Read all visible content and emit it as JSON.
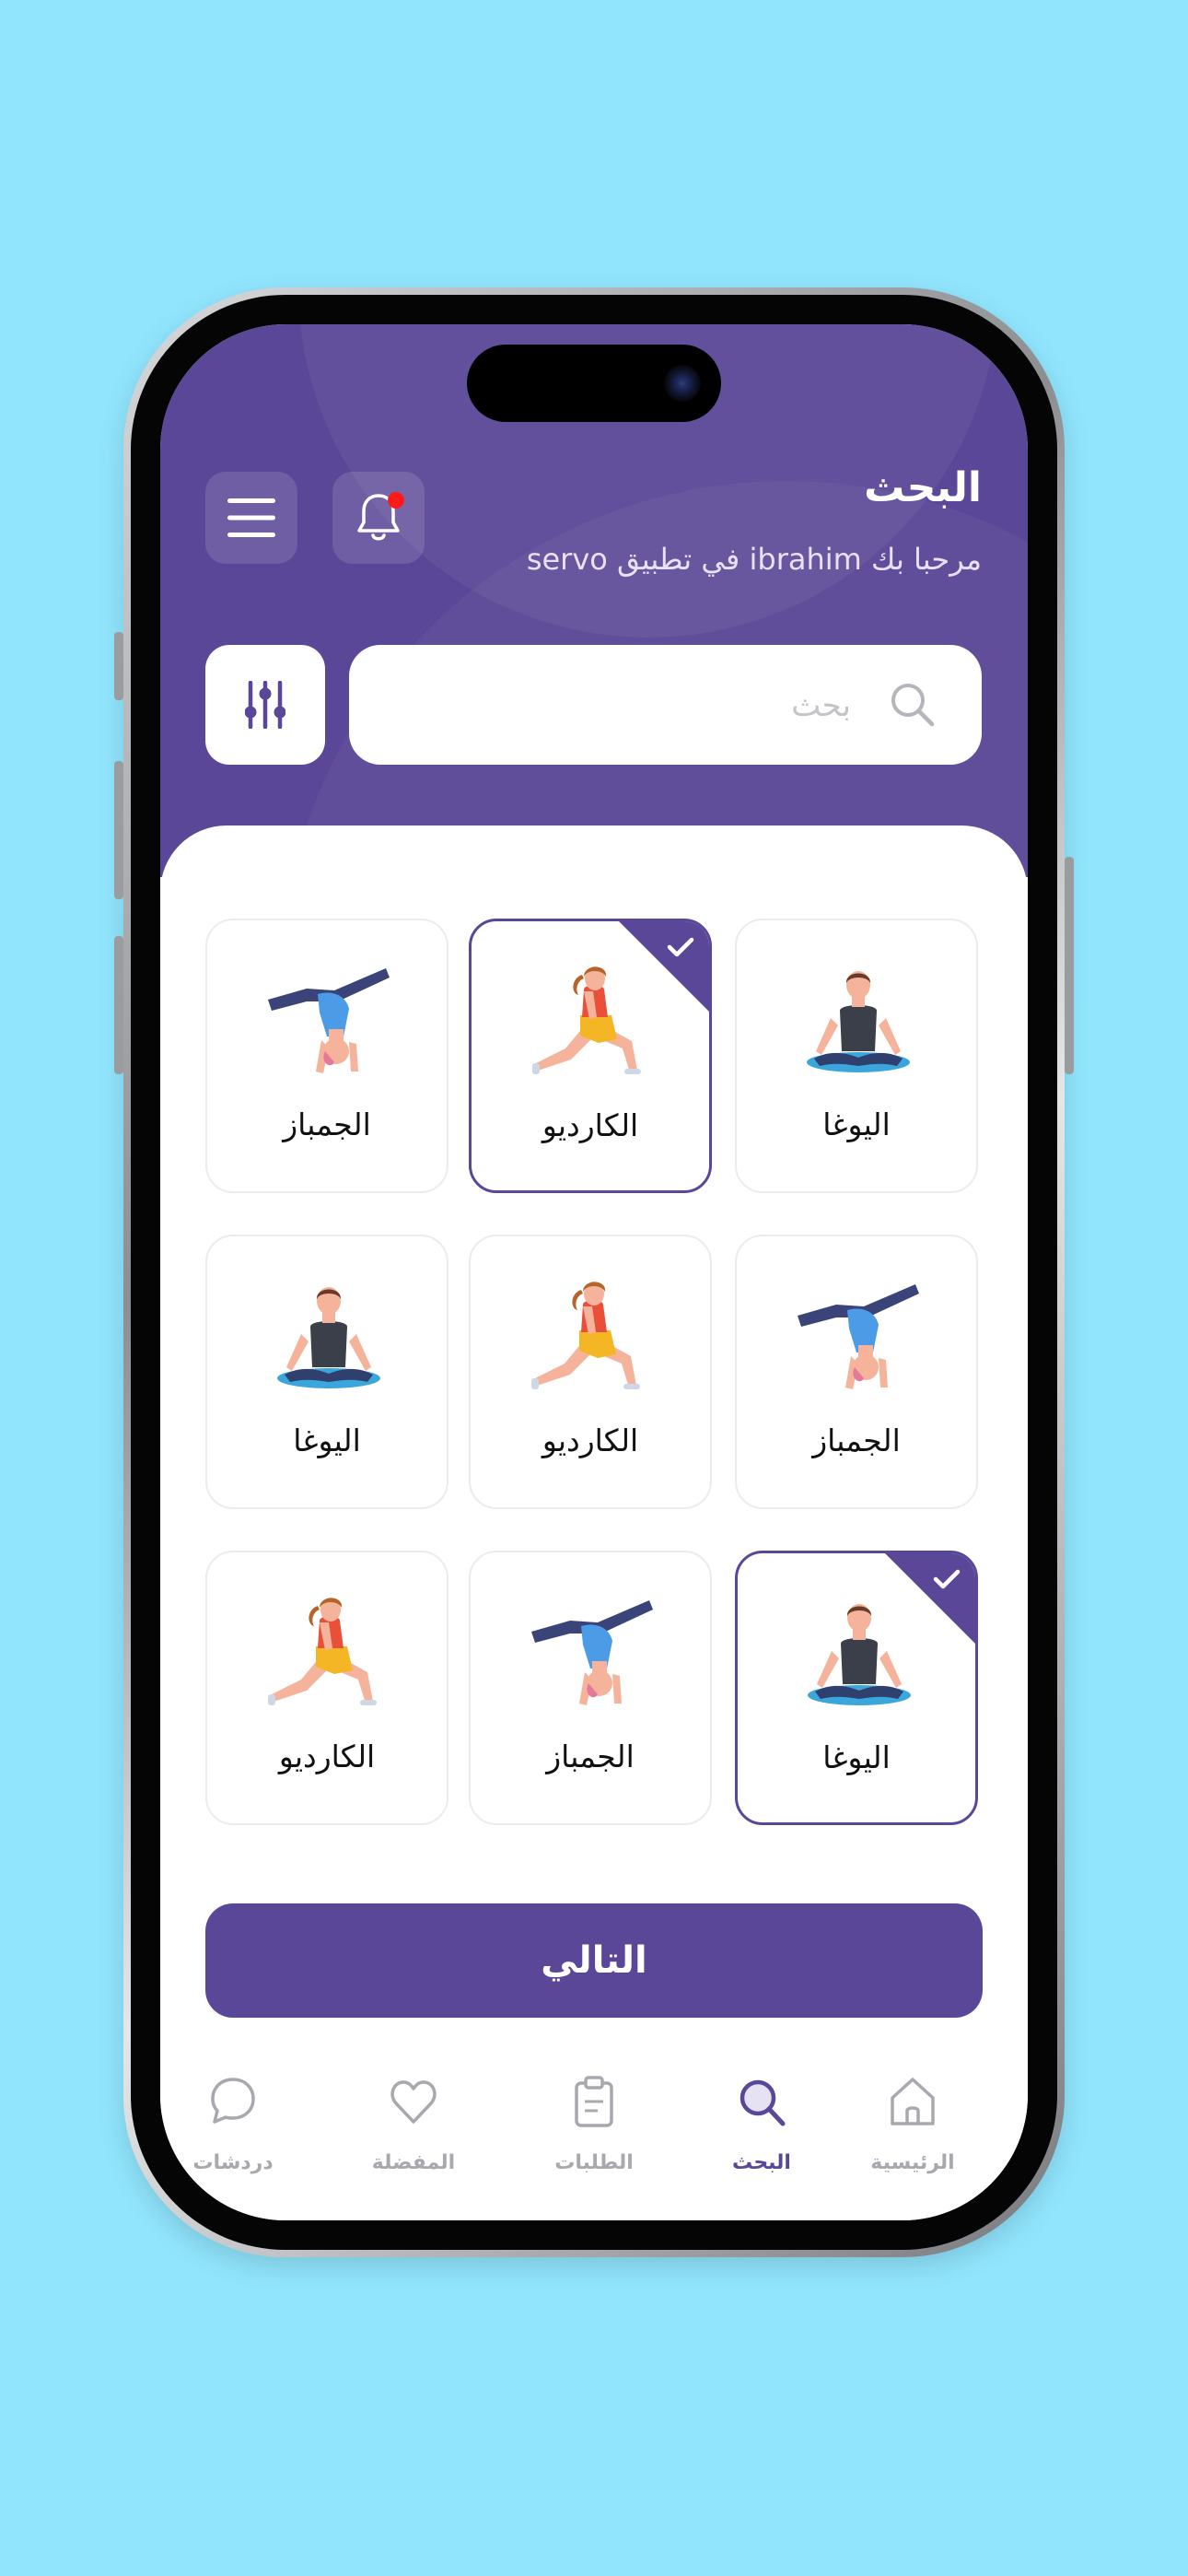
{
  "colors": {
    "background": "#91e6fe",
    "primary": "#5a4797",
    "tab_inactive": "#a8a8ae",
    "notification": "#ff1a1a"
  },
  "header": {
    "title": "البحث",
    "subtitle": "مرحبا بك ibrahim في تطبيق servo",
    "menu_icon": "hamburger-icon",
    "notification_icon": "bell-icon"
  },
  "search": {
    "placeholder": "بحث",
    "value": "",
    "icon": "search-icon",
    "filter_icon": "sliders-icon"
  },
  "categories": [
    {
      "label": "اليوغا",
      "figure": "yoga-figure",
      "selected": false
    },
    {
      "label": "الكارديو",
      "figure": "cardio-figure",
      "selected": true
    },
    {
      "label": "الجمباز",
      "figure": "gymnastics-figure",
      "selected": false
    },
    {
      "label": "الجمباز",
      "figure": "gymnastics-figure",
      "selected": false
    },
    {
      "label": "الكارديو",
      "figure": "cardio-figure",
      "selected": false
    },
    {
      "label": "اليوغا",
      "figure": "yoga-figure",
      "selected": false
    },
    {
      "label": "اليوغا",
      "figure": "yoga-figure",
      "selected": true
    },
    {
      "label": "الجمباز",
      "figure": "gymnastics-figure",
      "selected": false
    },
    {
      "label": "الكارديو",
      "figure": "cardio-figure",
      "selected": false
    }
  ],
  "next_button": {
    "label": "التالي"
  },
  "tabbar": {
    "items": [
      {
        "label": "الرئيسية",
        "icon": "home-icon",
        "active": false
      },
      {
        "label": "البحث",
        "icon": "search-icon",
        "active": true
      },
      {
        "label": "الطلبات",
        "icon": "clipboard-icon",
        "active": false
      },
      {
        "label": "المفضلة",
        "icon": "heart-icon",
        "active": false
      },
      {
        "label": "دردشات",
        "icon": "chat-bubble-icon",
        "active": false
      }
    ]
  }
}
